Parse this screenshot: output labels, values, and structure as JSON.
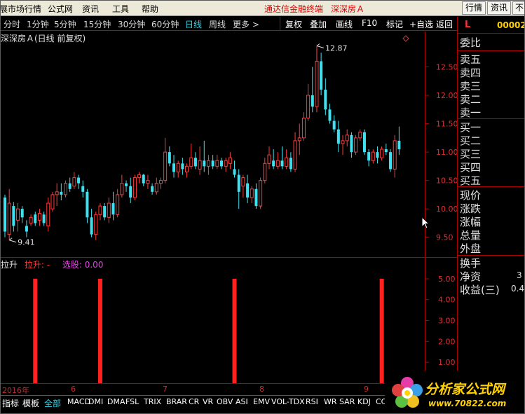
{
  "menu": {
    "items": [
      "展市场行情",
      "公式网",
      "资讯",
      "工具",
      "帮助"
    ],
    "app_title": "通达信金融终端",
    "stock_title": "深深房Ａ",
    "right_buttons": [
      "行情",
      "资讯",
      "不"
    ]
  },
  "periods": {
    "items": [
      "分时",
      "1分钟",
      "5分钟",
      "15分钟",
      "30分钟",
      "60分钟",
      "日线",
      "周线",
      "更多 >"
    ],
    "active": "日线",
    "tools": [
      "复权",
      "叠加",
      "画线",
      "F10",
      "标记",
      "+自选",
      "返回"
    ]
  },
  "chart": {
    "title": "深深房Ａ(日线 前复权)",
    "marker_icon": "diamond-icon",
    "high_label": "12.87",
    "low_label": "9.41",
    "price_ticks": [
      "12.50",
      "12.00",
      "11.50",
      "11.00",
      "10.50",
      "10.00",
      "9.50"
    ]
  },
  "indicator": {
    "name": "拉升",
    "line_label": "拉升: -",
    "select_label": "选股: 0.00",
    "ticks": [
      "5.00",
      "4.00",
      "3.00",
      "2.00",
      "1.00"
    ]
  },
  "date_axis": [
    "2016年",
    "6",
    "7",
    "8",
    "9"
  ],
  "tabs": [
    "指标",
    "模板",
    "全部",
    "MACD",
    "DMI",
    "DMA",
    "FSL",
    "TRIX",
    "BRAR",
    "CR",
    "VR",
    "OBV",
    "ASI",
    "EMV",
    "VOL-TDX",
    "RSI",
    "WR",
    "SAR",
    "KDJ",
    "CCI"
  ],
  "active_tab": "全部",
  "quote_panel": {
    "marker": "L",
    "code": "00002",
    "rows": [
      "委比",
      "卖五",
      "卖四",
      "卖三",
      "卖二",
      "卖一",
      "买一",
      "买二",
      "买三",
      "买四",
      "买五",
      "现价",
      "涨跌",
      "涨幅",
      "总量",
      "外盘",
      "换手",
      "净资",
      "收益(三)"
    ],
    "net_asset_value": "3",
    "eps_value": "0.4"
  },
  "logo": {
    "text": "分析家公式网",
    "url": "www.70822.com"
  },
  "colors": {
    "up": "#ff3b3b",
    "down": "#3fe0f0",
    "axis": "#b00000",
    "active": "#2fd3e6"
  },
  "chart_data": {
    "type": "candlestick",
    "ylim": [
      9.2,
      13.0
    ],
    "ohlc": [
      [
        10.2,
        10.25,
        9.5,
        9.6
      ],
      [
        9.55,
        10.35,
        9.45,
        10.1
      ],
      [
        10.05,
        10.12,
        9.6,
        9.7
      ],
      [
        9.8,
        10.1,
        9.6,
        10.0
      ],
      [
        10.0,
        10.05,
        9.75,
        9.85
      ],
      [
        9.7,
        9.8,
        9.5,
        9.6
      ],
      [
        9.75,
        9.9,
        9.7,
        9.85
      ],
      [
        9.9,
        9.95,
        9.7,
        9.75
      ],
      [
        9.8,
        10.0,
        9.7,
        9.92
      ],
      [
        9.9,
        9.95,
        9.7,
        9.75
      ],
      [
        9.7,
        10.2,
        9.6,
        10.1
      ],
      [
        10.0,
        10.3,
        9.95,
        10.25
      ],
      [
        10.25,
        10.45,
        10.05,
        10.3
      ],
      [
        10.3,
        10.45,
        10.15,
        10.25
      ],
      [
        10.25,
        10.5,
        10.2,
        10.45
      ],
      [
        10.45,
        10.55,
        10.3,
        10.35
      ],
      [
        10.4,
        10.65,
        10.35,
        10.55
      ],
      [
        10.55,
        10.6,
        10.35,
        10.45
      ],
      [
        10.4,
        10.5,
        10.2,
        10.3
      ],
      [
        10.3,
        10.35,
        9.75,
        9.85
      ],
      [
        9.85,
        10.0,
        9.5,
        9.55
      ],
      [
        9.55,
        9.95,
        9.45,
        9.9
      ],
      [
        9.9,
        10.1,
        9.8,
        10.05
      ],
      [
        10.05,
        10.1,
        9.8,
        9.85
      ],
      [
        9.85,
        10.2,
        9.75,
        10.1
      ],
      [
        10.1,
        10.3,
        9.8,
        9.9
      ],
      [
        9.9,
        10.35,
        9.85,
        10.25
      ],
      [
        10.25,
        10.6,
        10.2,
        10.45
      ],
      [
        10.45,
        10.5,
        10.3,
        10.4
      ],
      [
        10.4,
        10.55,
        10.1,
        10.2
      ],
      [
        10.2,
        10.6,
        10.15,
        10.55
      ],
      [
        10.55,
        10.65,
        10.45,
        10.6
      ],
      [
        10.6,
        10.62,
        10.4,
        10.45
      ],
      [
        10.45,
        10.6,
        10.35,
        10.5
      ],
      [
        10.4,
        10.45,
        10.25,
        10.3
      ],
      [
        10.3,
        10.55,
        10.25,
        10.45
      ],
      [
        10.45,
        10.55,
        10.35,
        10.5
      ],
      [
        10.5,
        11.25,
        10.45,
        11.0
      ],
      [
        11.0,
        11.1,
        10.75,
        10.8
      ],
      [
        10.8,
        10.95,
        10.55,
        10.65
      ],
      [
        10.65,
        10.85,
        10.55,
        10.8
      ],
      [
        10.8,
        10.9,
        10.6,
        10.7
      ],
      [
        10.65,
        10.8,
        10.55,
        10.75
      ],
      [
        10.75,
        11.15,
        10.7,
        10.9
      ],
      [
        10.9,
        11.0,
        10.7,
        10.75
      ],
      [
        10.7,
        11.1,
        10.6,
        10.85
      ],
      [
        10.85,
        11.2,
        10.65,
        10.75
      ],
      [
        10.75,
        10.95,
        10.6,
        10.85
      ],
      [
        10.85,
        10.95,
        10.7,
        10.75
      ],
      [
        10.75,
        10.95,
        10.7,
        10.85
      ],
      [
        10.85,
        10.9,
        10.7,
        10.75
      ],
      [
        10.75,
        10.9,
        10.65,
        10.85
      ],
      [
        10.8,
        11.0,
        10.7,
        10.9
      ],
      [
        10.7,
        10.85,
        10.55,
        10.6
      ],
      [
        10.6,
        10.7,
        10.0,
        10.3
      ],
      [
        10.4,
        10.6,
        10.2,
        10.55
      ],
      [
        10.45,
        10.6,
        10.1,
        10.2
      ],
      [
        10.2,
        10.4,
        10.1,
        10.35
      ],
      [
        10.35,
        10.45,
        10.0,
        10.05
      ],
      [
        10.05,
        10.55,
        10.0,
        10.5
      ],
      [
        10.5,
        10.9,
        10.45,
        10.8
      ],
      [
        10.8,
        11.1,
        10.7,
        10.95
      ],
      [
        10.85,
        11.05,
        10.7,
        10.75
      ],
      [
        10.75,
        11.0,
        10.7,
        10.85
      ],
      [
        10.85,
        11.1,
        10.7,
        10.75
      ],
      [
        10.75,
        11.05,
        10.7,
        10.9
      ],
      [
        10.9,
        11.0,
        10.65,
        10.7
      ],
      [
        10.7,
        11.35,
        10.65,
        11.2
      ],
      [
        11.2,
        11.5,
        10.95,
        11.25
      ],
      [
        11.25,
        11.7,
        11.2,
        11.6
      ],
      [
        11.6,
        12.2,
        11.55,
        12.0
      ],
      [
        12.0,
        12.5,
        11.7,
        11.8
      ],
      [
        11.8,
        12.87,
        11.7,
        12.6
      ],
      [
        12.6,
        12.75,
        12.0,
        12.1
      ],
      [
        12.1,
        12.3,
        11.65,
        11.75
      ],
      [
        11.75,
        11.85,
        11.5,
        11.55
      ],
      [
        11.55,
        11.65,
        11.35,
        11.4
      ],
      [
        11.4,
        11.55,
        11.0,
        11.15
      ],
      [
        11.15,
        11.3,
        10.95,
        11.2
      ],
      [
        11.2,
        11.4,
        11.1,
        11.3
      ],
      [
        11.3,
        11.35,
        10.9,
        11.0
      ],
      [
        11.0,
        11.3,
        10.95,
        11.25
      ],
      [
        11.25,
        11.4,
        11.2,
        11.35
      ],
      [
        11.35,
        11.4,
        10.95,
        11.0
      ],
      [
        11.0,
        11.05,
        10.75,
        10.85
      ],
      [
        10.85,
        11.05,
        10.8,
        11.0
      ],
      [
        11.0,
        11.1,
        10.8,
        10.9
      ],
      [
        10.9,
        11.1,
        10.85,
        11.05
      ],
      [
        11.05,
        11.15,
        10.95,
        11.0
      ],
      [
        11.0,
        11.05,
        10.65,
        10.7
      ],
      [
        10.7,
        11.3,
        10.55,
        11.2
      ],
      [
        11.2,
        11.45,
        10.95,
        11.05
      ]
    ],
    "indicator_pulses": {
      "index": [
        7,
        22,
        53,
        87
      ],
      "value": 5.0
    },
    "indicator_ylim": [
      0,
      5.5
    ]
  }
}
